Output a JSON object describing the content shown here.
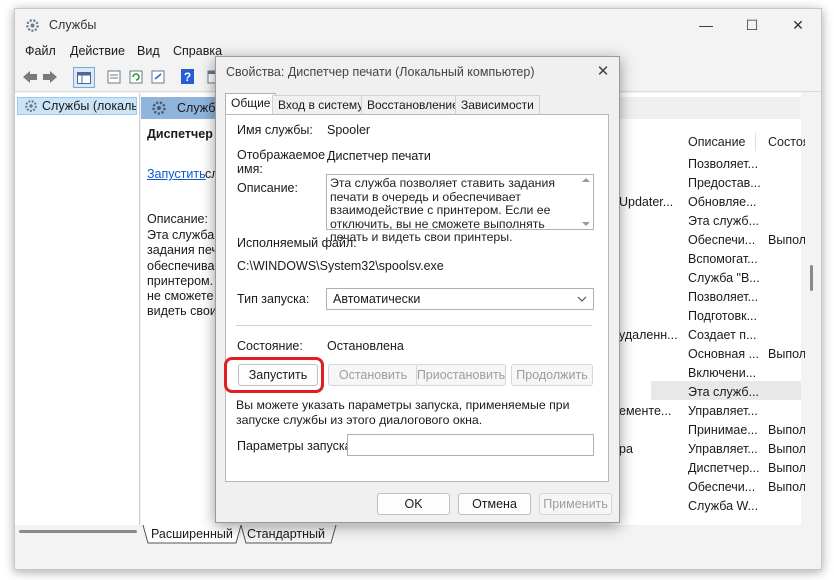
{
  "window": {
    "title": "Службы",
    "controls": {
      "minimize": "—",
      "maximize": "☐",
      "close": "✕"
    }
  },
  "menu": [
    "Файл",
    "Действие",
    "Вид",
    "Справка"
  ],
  "tree": {
    "item": "Службы (локалы"
  },
  "content": {
    "header_label": "Служб",
    "detail_title": "Диспетчер п",
    "start_link": "Запустить",
    "start_link_rest": "сл",
    "description_label": "Описание:",
    "description_text": "Эта служба п\nзадания печа\nобеспечивае\nпринтером. \nне сможете \nвидеть свои"
  },
  "columns": {
    "description": "Описание",
    "state": "Состоян"
  },
  "rows": [
    {
      "left": "",
      "desc": "Позволяет...",
      "state": ""
    },
    {
      "left": "",
      "desc": "Предостав...",
      "state": ""
    },
    {
      "left": "Updater...",
      "desc": "Обновляе...",
      "state": ""
    },
    {
      "left": "",
      "desc": "Эта служб...",
      "state": ""
    },
    {
      "left": "",
      "desc": "Обеспечи...",
      "state": "Выполня"
    },
    {
      "left": "",
      "desc": "Вспомогат...",
      "state": ""
    },
    {
      "left": "",
      "desc": "Служба \"В...",
      "state": ""
    },
    {
      "left": "",
      "desc": "Позволяет...",
      "state": ""
    },
    {
      "left": "",
      "desc": "Подготовк...",
      "state": ""
    },
    {
      "left": "удаленн...",
      "desc": "Создает п...",
      "state": ""
    },
    {
      "left": "",
      "desc": "Основная ...",
      "state": "Выполня"
    },
    {
      "left": "",
      "desc": "Включени...",
      "state": ""
    },
    {
      "left": "",
      "desc": "Эта служб...",
      "state": ""
    },
    {
      "left": "ементе...",
      "desc": "Управляет...",
      "state": ""
    },
    {
      "left": "",
      "desc": "Принимае...",
      "state": "Выполня"
    },
    {
      "left": "ра",
      "desc": "Управляет...",
      "state": "Выполня"
    },
    {
      "left": "",
      "desc": "Диспетчер...",
      "state": "Выполня"
    },
    {
      "left": "",
      "desc": "Обеспечи...",
      "state": "Выполня"
    },
    {
      "left": "",
      "desc": "Служба W...",
      "state": ""
    }
  ],
  "bottom_tabs": [
    "Расширенный",
    "Стандартный"
  ],
  "dialog": {
    "title": "Свойства: Диспетчер печати (Локальный компьютер)",
    "close": "✕",
    "tabs": [
      "Общие",
      "Вход в систему",
      "Восстановление",
      "Зависимости"
    ],
    "service_name_label": "Имя службы:",
    "service_name": "Spooler",
    "display_name_label": "Отображаемое имя:",
    "display_name": "Диспетчер печати",
    "description_label": "Описание:",
    "description": "Эта служба позволяет ставить задания печати в очередь и обеспечивает взаимодействие с принтером.  Если ее отключить, вы не сможете выполнять печать и видеть свои принтеры.",
    "exe_label": "Исполняемый файл:",
    "exe_path": "C:\\WINDOWS\\System32\\spoolsv.exe",
    "startup_type_label": "Тип запуска:",
    "startup_type": "Автоматически",
    "status_label": "Состояние:",
    "status_value": "Остановлена",
    "buttons": {
      "start": "Запустить",
      "stop": "Остановить",
      "pause": "Приостановить",
      "resume": "Продолжить"
    },
    "note": "Вы можете указать параметры запуска, применяемые при запуске службы из этого диалогового окна.",
    "params_label": "Параметры запуска:",
    "params_value": "",
    "ok": "OK",
    "cancel": "Отмена",
    "apply": "Применить"
  },
  "colors": {
    "highlight": "#e02020",
    "selection": "#cce4f7",
    "header_blue": "#8fb5dc",
    "link": "#0b57d0"
  }
}
